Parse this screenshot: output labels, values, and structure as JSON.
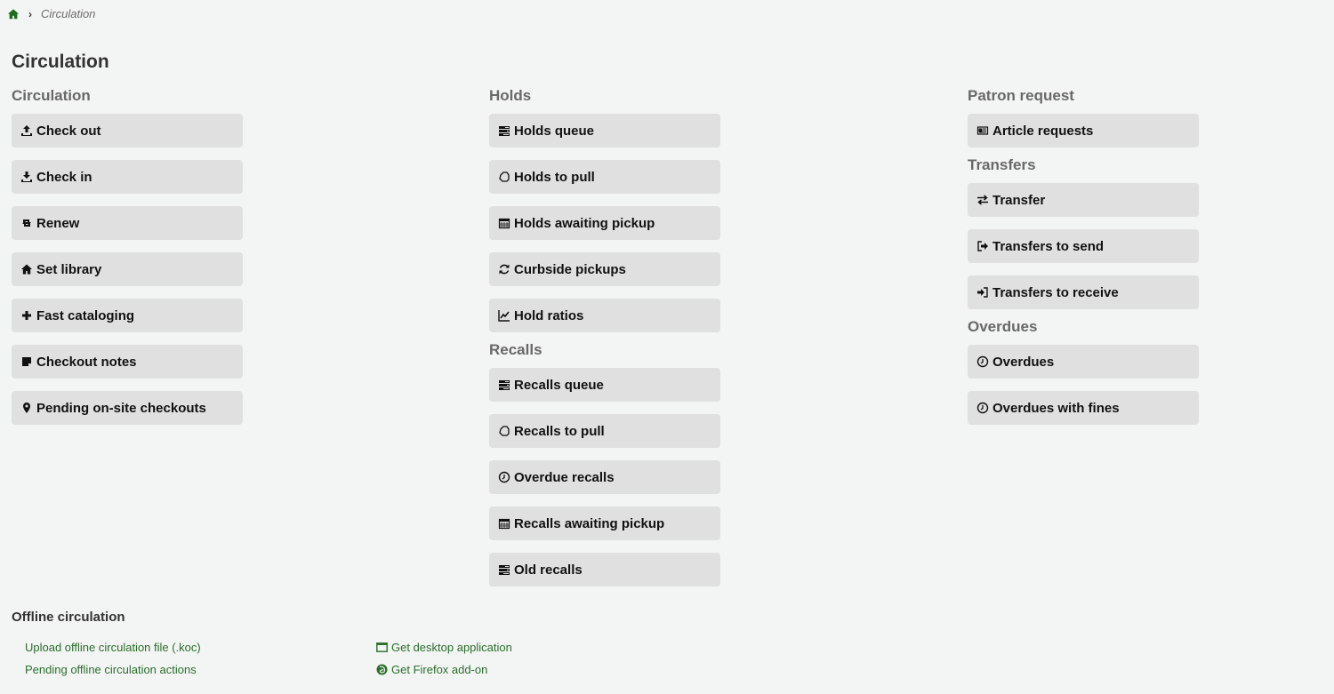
{
  "breadcrumb": {
    "home_icon": "home-icon",
    "current": "Circulation"
  },
  "page_title": "Circulation",
  "columns": {
    "left": {
      "sections": [
        {
          "heading": "Circulation",
          "items": [
            {
              "label": "Check out",
              "icon": "upload-icon"
            },
            {
              "label": "Check in",
              "icon": "download-icon"
            },
            {
              "label": "Renew",
              "icon": "retweet-icon"
            },
            {
              "label": "Set library",
              "icon": "home-icon"
            },
            {
              "label": "Fast cataloging",
              "icon": "plus-icon"
            },
            {
              "label": "Checkout notes",
              "icon": "sticky-note-icon"
            },
            {
              "label": "Pending on-site checkouts",
              "icon": "map-marker-icon"
            }
          ]
        }
      ]
    },
    "middle": {
      "sections": [
        {
          "heading": "Holds",
          "items": [
            {
              "label": "Holds queue",
              "icon": "tasks-icon"
            },
            {
              "label": "Holds to pull",
              "icon": "hand-icon"
            },
            {
              "label": "Holds awaiting pickup",
              "icon": "calendar-icon"
            },
            {
              "label": "Curbside pickups",
              "icon": "refresh-icon"
            },
            {
              "label": "Hold ratios",
              "icon": "line-chart-icon"
            }
          ]
        },
        {
          "heading": "Recalls",
          "items": [
            {
              "label": "Recalls queue",
              "icon": "tasks-icon"
            },
            {
              "label": "Recalls to pull",
              "icon": "hand-icon"
            },
            {
              "label": "Overdue recalls",
              "icon": "clock-icon"
            },
            {
              "label": "Recalls awaiting pickup",
              "icon": "calendar-icon"
            },
            {
              "label": "Old recalls",
              "icon": "tasks-icon"
            }
          ]
        }
      ]
    },
    "right": {
      "sections": [
        {
          "heading": "Patron request",
          "items": [
            {
              "label": "Article requests",
              "icon": "newspaper-icon"
            }
          ]
        },
        {
          "heading": "Transfers",
          "items": [
            {
              "label": "Transfer",
              "icon": "exchange-icon"
            },
            {
              "label": "Transfers to send",
              "icon": "sign-out-icon"
            },
            {
              "label": "Transfers to receive",
              "icon": "sign-in-icon"
            }
          ]
        },
        {
          "heading": "Overdues",
          "items": [
            {
              "label": "Overdues",
              "icon": "clock-icon"
            },
            {
              "label": "Overdues with fines",
              "icon": "clock-icon"
            }
          ]
        }
      ]
    }
  },
  "offline": {
    "heading": "Offline circulation",
    "left_links": [
      {
        "label": "Upload offline circulation file (.koc)"
      },
      {
        "label": "Pending offline circulation actions"
      }
    ],
    "right_links": [
      {
        "label": "Get desktop application",
        "icon": "window-icon"
      },
      {
        "label": "Get Firefox add-on",
        "icon": "firefox-icon"
      }
    ]
  },
  "colors": {
    "background": "#f3f4f4",
    "button_bg": "#e0e0e0",
    "heading": "#696969",
    "link": "#2a6f2a"
  }
}
